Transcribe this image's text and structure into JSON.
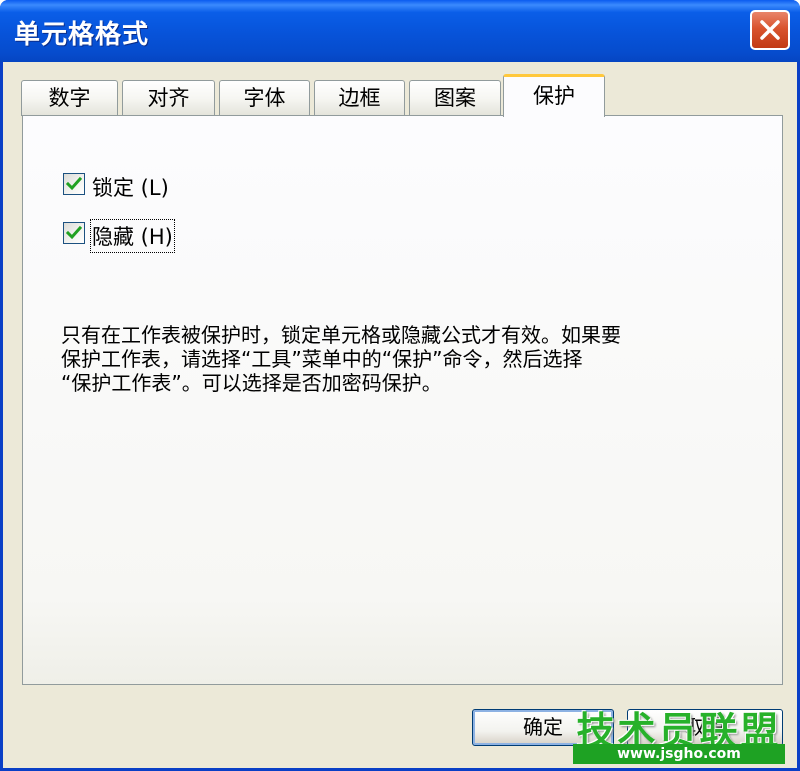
{
  "window": {
    "title": "单元格格式",
    "close_icon": "close-icon"
  },
  "tabs": [
    {
      "label": "数字",
      "active": false
    },
    {
      "label": "对齐",
      "active": false
    },
    {
      "label": "字体",
      "active": false
    },
    {
      "label": "边框",
      "active": false
    },
    {
      "label": "图案",
      "active": false
    },
    {
      "label": "保护",
      "active": true
    }
  ],
  "protection": {
    "locked": {
      "label": "锁定 (L)",
      "checked": true
    },
    "hidden": {
      "label": "隐藏 (H)",
      "checked": true
    },
    "description": [
      "只有在工作表被保护时，锁定单元格或隐藏公式才有效。如果要",
      "保护工作表，请选择“工具”菜单中的“保护”命令，然后选择",
      "“保护工作表”。可以选择是否加密码保护。"
    ]
  },
  "buttons": {
    "ok": "确定",
    "cancel": "取消"
  },
  "watermark": {
    "text": "技术员联盟",
    "url": "www.jsgho.com"
  },
  "colors": {
    "titlebar": "#0753d9",
    "close_button": "#d9542e",
    "active_tab_accent": "#ffc83c",
    "check_mark": "#21a121",
    "watermark": "#27b12a"
  }
}
